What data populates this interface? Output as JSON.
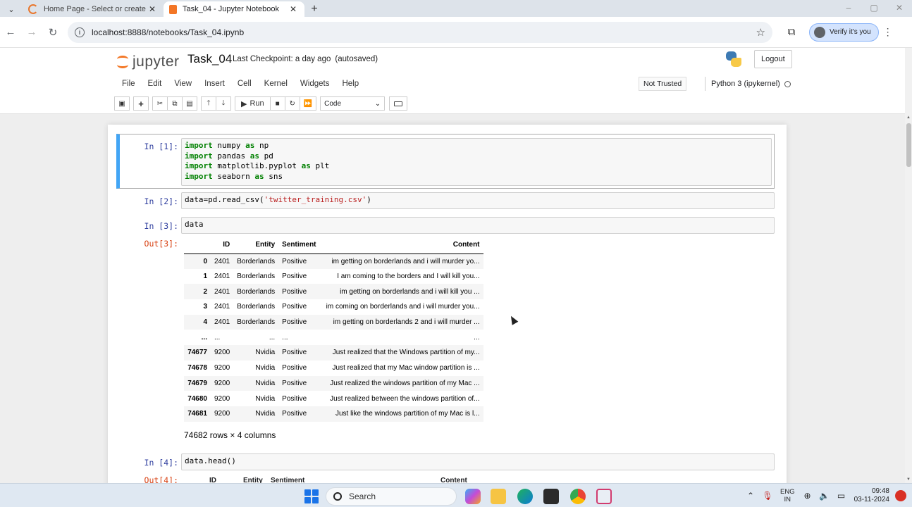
{
  "browser": {
    "tabs": [
      {
        "title": "Home Page - Select or create a",
        "close": "✕"
      },
      {
        "title": "Task_04 - Jupyter Notebook",
        "close": "✕"
      }
    ],
    "new_tab": "+",
    "url": "localhost:8888/notebooks/Task_04.ipynb",
    "verify_label": "Verify it's you"
  },
  "jupyter": {
    "logo_text": "jupyter",
    "notebook_name": "Task_04",
    "checkpoint": "Last Checkpoint: a day ago",
    "autosave": "(autosaved)",
    "logout": "Logout",
    "menu": [
      "File",
      "Edit",
      "View",
      "Insert",
      "Cell",
      "Kernel",
      "Widgets",
      "Help"
    ],
    "trust": "Not Trusted",
    "kernel": "Python 3 (ipykernel)",
    "run_label": "Run",
    "cell_type": "Code"
  },
  "cells": {
    "c1": {
      "prompt": "In [1]:"
    },
    "c2": {
      "prompt": "In [2]:"
    },
    "c3": {
      "prompt": "In [3]:",
      "code": "data",
      "out_prompt": "Out[3]:"
    },
    "c4": {
      "prompt": "In [4]:",
      "code": "data.head()",
      "out_prompt": "Out[4]:"
    }
  },
  "dataframe": {
    "columns": [
      "",
      "ID",
      "Entity",
      "Sentiment",
      "Content"
    ],
    "rows": [
      [
        "0",
        "2401",
        "Borderlands",
        "Positive",
        "im getting on borderlands and i will murder yo..."
      ],
      [
        "1",
        "2401",
        "Borderlands",
        "Positive",
        "I am coming to the borders and I will kill you..."
      ],
      [
        "2",
        "2401",
        "Borderlands",
        "Positive",
        "im getting on borderlands and i will kill you ..."
      ],
      [
        "3",
        "2401",
        "Borderlands",
        "Positive",
        "im coming on borderlands and i will murder you..."
      ],
      [
        "4",
        "2401",
        "Borderlands",
        "Positive",
        "im getting on borderlands 2 and i will murder ..."
      ],
      [
        "...",
        "...",
        "...",
        "...",
        "..."
      ],
      [
        "74677",
        "9200",
        "Nvidia",
        "Positive",
        "Just realized that the Windows partition of my..."
      ],
      [
        "74678",
        "9200",
        "Nvidia",
        "Positive",
        "Just realized that my Mac window partition is ..."
      ],
      [
        "74679",
        "9200",
        "Nvidia",
        "Positive",
        "Just realized the windows partition of my Mac ..."
      ],
      [
        "74680",
        "9200",
        "Nvidia",
        "Positive",
        "Just realized between the windows partition of..."
      ],
      [
        "74681",
        "9200",
        "Nvidia",
        "Positive",
        "Just like the windows partition of my Mac is l..."
      ]
    ],
    "shape": "74682 rows × 4 columns"
  },
  "head_columns": [
    "ID",
    "Entity",
    "Sentiment",
    "Content"
  ],
  "taskbar": {
    "search": "Search",
    "lang_top": "ENG",
    "lang_bottom": "IN",
    "time": "09:48",
    "date": "03-11-2024"
  },
  "colors": {
    "accent": "#f37726",
    "selected_cell": "#42a5f5",
    "prompt_in": "#303f9f",
    "prompt_out": "#d84315"
  }
}
